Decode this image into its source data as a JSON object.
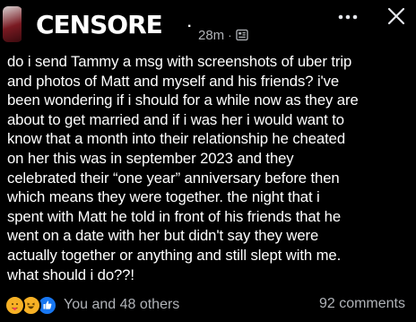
{
  "header": {
    "censor_label": "CENSORE",
    "censor_tail": ".",
    "time": "28m",
    "separator": "·"
  },
  "post": {
    "text": "do i send Tammy a msg with screenshots of uber trip\nand photos of Matt and myself and his friends? i've\nbeen wondering if i should for a while now as they are\nabout to get married and if i was her i would want to\nknow that a month into their relationship he cheated\non her this was in september 2023 and they\ncelebrated their “one year” anniversary before then\nwhich means they were together. the night that i\nspent with Matt he told in front of his friends that he\nwent on a date with her but didn't say they were\nactually together or anything and still slept with me.\nwhat should i do??!"
  },
  "footer": {
    "reactions_text": "You and 48 others",
    "comments_text": "92 comments",
    "reaction_icons": [
      "care-reaction-icon",
      "haha-reaction-icon",
      "like-reaction-icon"
    ]
  },
  "colors": {
    "background": "#000000",
    "text": "#ffffff",
    "muted": "#b0b3b8",
    "like_blue": "#1877f2",
    "emoji_yellow": "#f7b125"
  },
  "icons": [
    "privacy-icon",
    "more-icon",
    "close-icon"
  ]
}
